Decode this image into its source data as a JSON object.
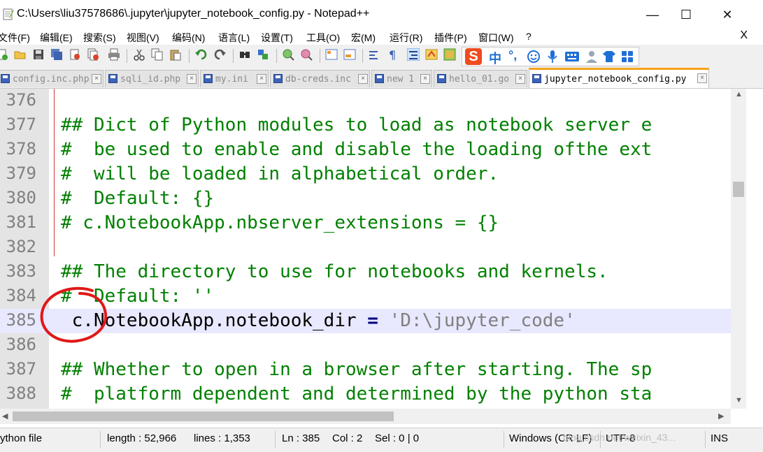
{
  "window": {
    "title": "C:\\Users\\liu37578686\\.jupyter\\jupyter_notebook_config.py - Notepad++",
    "minimize": "—",
    "maximize": "☐",
    "close": "✕"
  },
  "menu": {
    "items": [
      "文件(F)",
      "编辑(E)",
      "搜索(S)",
      "视图(V)",
      "编码(N)",
      "语言(L)",
      "设置(T)",
      "工具(O)",
      "宏(M)",
      "运行(R)",
      "插件(P)",
      "窗口(W)",
      "?"
    ],
    "close": "X"
  },
  "ime": {
    "logo": "S",
    "lang": "中",
    "punct": "°,"
  },
  "tabs": [
    {
      "label": "config.inc.php",
      "active": false
    },
    {
      "label": "sqli_id.php",
      "active": false
    },
    {
      "label": "my.ini",
      "active": false
    },
    {
      "label": "db-creds.inc",
      "active": false
    },
    {
      "label": "new 1",
      "active": false
    },
    {
      "label": "hello_01.go",
      "active": false
    },
    {
      "label": "jupyter_notebook_config.py",
      "active": true
    }
  ],
  "editor": {
    "lines": [
      {
        "num": "376",
        "text": ""
      },
      {
        "num": "377",
        "text": "## Dict of Python modules to load as notebook server e"
      },
      {
        "num": "378",
        "text": "#  be used to enable and disable the loading ofthe ext"
      },
      {
        "num": "379",
        "text": "#  will be loaded in alphabetical order."
      },
      {
        "num": "380",
        "text": "#  Default: {}"
      },
      {
        "num": "381",
        "text": "# c.NotebookApp.nbserver_extensions = {}"
      },
      {
        "num": "382",
        "text": ""
      },
      {
        "num": "383",
        "text": "## The directory to use for notebooks and kernels."
      },
      {
        "num": "384",
        "text": "#  Default: ''"
      },
      {
        "num": "385",
        "code": " c.NotebookApp.notebook_dir",
        "op": " = ",
        "str": "'D:\\jupyter_code'",
        "current": true
      },
      {
        "num": "386",
        "text": ""
      },
      {
        "num": "387",
        "text": "## Whether to open in a browser after starting. The sp"
      },
      {
        "num": "388",
        "text": "#  platform dependent and determined by the python sta"
      }
    ]
  },
  "status": {
    "file_type": "ython file",
    "length": "length : 52,966",
    "lines": "lines : 1,353",
    "ln": "Ln : 385",
    "col": "Col : 2",
    "sel": "Sel : 0 | 0",
    "eol": "Windows (CR LF)",
    "encoding": "UTF-8",
    "mode": "INS",
    "watermark": "blog.csdn.net/weixin_43..."
  }
}
